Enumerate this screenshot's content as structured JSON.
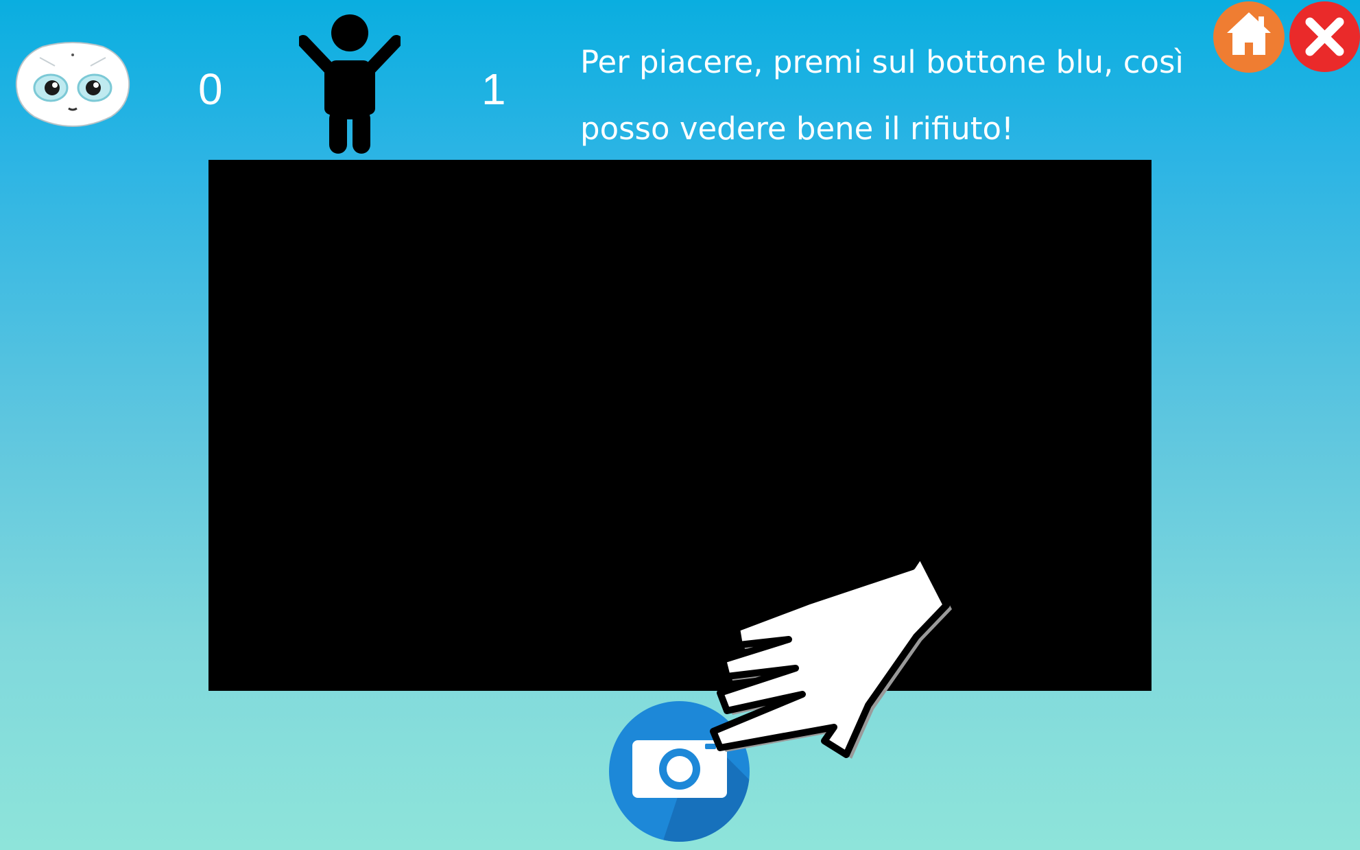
{
  "scoreboard": {
    "robot_score": "0",
    "child_score": "1"
  },
  "instruction": {
    "line1": "Per piacere, premi sul bottone blu, così",
    "line2": "posso vedere bene il rifiuto!"
  },
  "icons": {
    "robot": "robot-face-icon",
    "child": "child-icon",
    "home": "home-icon",
    "close": "close-icon",
    "camera": "camera-icon",
    "hand": "pointing-hand-icon"
  },
  "colors": {
    "home_button": "#ef7d32",
    "close_button": "#ea2a2a",
    "camera_button": "#1d88d8",
    "camera_view": "#000000"
  }
}
